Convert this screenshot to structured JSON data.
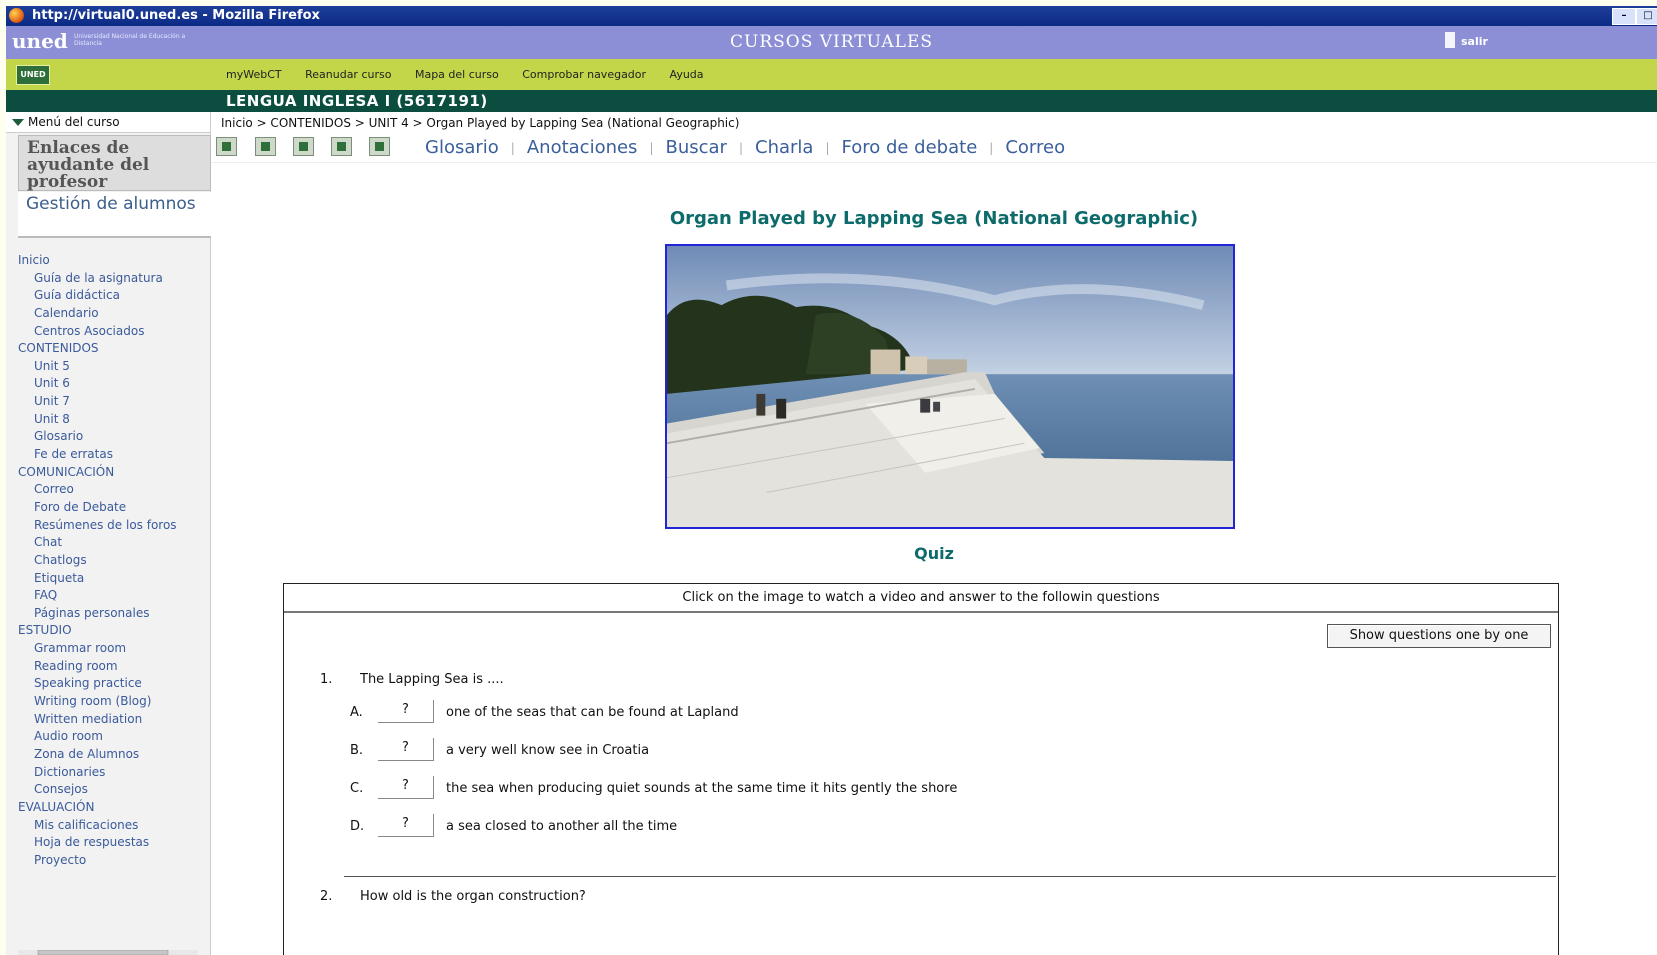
{
  "window": {
    "title": "http://virtual0.uned.es - Mozilla Firefox",
    "buttons": [
      "–",
      "□"
    ]
  },
  "header": {
    "logo": "uned",
    "logo_subtitle": "Universidad Nacional de Educación a Distancia",
    "title": "CURSOS VIRTUALES",
    "exit": "salir",
    "badge": "UNED"
  },
  "nav": {
    "items": [
      "myWebCT",
      "Reanudar curso",
      "Mapa del curso",
      "Comprobar navegador",
      "Ayuda"
    ]
  },
  "course": {
    "title": "LENGUA INGLESA I  (5617191)"
  },
  "sidebar": {
    "menu_title": "Menú del curso",
    "help_box": "Enlaces de ayudante del profesor",
    "gestion": "Gestión de alumnos",
    "entries": [
      {
        "label": "Inicio",
        "type": "sec"
      },
      {
        "label": "Guía de la asignatura",
        "type": "itm"
      },
      {
        "label": "Guía didáctica",
        "type": "itm"
      },
      {
        "label": "Calendario",
        "type": "itm"
      },
      {
        "label": "Centros Asociados",
        "type": "itm"
      },
      {
        "label": "CONTENIDOS",
        "type": "sec"
      },
      {
        "label": "Unit 5",
        "type": "itm"
      },
      {
        "label": "Unit 6",
        "type": "itm"
      },
      {
        "label": "Unit 7",
        "type": "itm"
      },
      {
        "label": "Unit 8",
        "type": "itm"
      },
      {
        "label": "Glosario",
        "type": "itm"
      },
      {
        "label": "Fe de erratas",
        "type": "itm"
      },
      {
        "label": "COMUNICACIÓN",
        "type": "sec"
      },
      {
        "label": "Correo",
        "type": "itm"
      },
      {
        "label": "Foro de Debate",
        "type": "itm"
      },
      {
        "label": "Resúmenes de los foros",
        "type": "itm"
      },
      {
        "label": "Chat",
        "type": "itm"
      },
      {
        "label": "Chatlogs",
        "type": "itm"
      },
      {
        "label": "Etiqueta",
        "type": "itm"
      },
      {
        "label": "FAQ",
        "type": "itm"
      },
      {
        "label": "Páginas personales",
        "type": "itm"
      },
      {
        "label": "ESTUDIO",
        "type": "sec"
      },
      {
        "label": "Grammar room",
        "type": "itm"
      },
      {
        "label": "Reading room",
        "type": "itm"
      },
      {
        "label": "Speaking practice",
        "type": "itm"
      },
      {
        "label": "Writing room (Blog)",
        "type": "itm"
      },
      {
        "label": "Written mediation",
        "type": "itm"
      },
      {
        "label": "Audio room",
        "type": "itm"
      },
      {
        "label": "Zona de Alumnos",
        "type": "itm"
      },
      {
        "label": "Dictionaries",
        "type": "itm"
      },
      {
        "label": "Consejos",
        "type": "itm"
      },
      {
        "label": "EVALUACIÓN",
        "type": "sec"
      },
      {
        "label": "Mis calificaciones",
        "type": "itm"
      },
      {
        "label": "Hoja de respuestas",
        "type": "itm"
      },
      {
        "label": "Proyecto",
        "type": "itm"
      }
    ]
  },
  "breadcrumb": "Inicio  >  CONTENIDOS  >  UNIT 4  >  Organ Played by Lapping Sea (National Geographic)",
  "toolnav": [
    "Glosario",
    "Anotaciones",
    "Buscar",
    "Charla",
    "Foro de debate",
    "Correo"
  ],
  "page": {
    "title": "Organ Played by Lapping Sea (National Geographic)",
    "quiz_label": "Quiz"
  },
  "quiz": {
    "instructions": "Click on the image to watch a video and answer to the followin questions",
    "show_button": "Show questions one by one",
    "q1": {
      "number": "1.",
      "text": "The Lapping Sea is ....",
      "options": [
        {
          "letter": "A.",
          "value": "?",
          "text": "one of the seas that can be found at Lapland"
        },
        {
          "letter": "B.",
          "value": "?",
          "text": "a very well know see in Croatia"
        },
        {
          "letter": "C.",
          "value": "?",
          "text": "the sea when producing quiet sounds at the same time it hits gently the shore"
        },
        {
          "letter": "D.",
          "value": "?",
          "text": "a sea closed to another all the time"
        }
      ]
    },
    "q2": {
      "number": "2.",
      "text": "How old is the organ construction?"
    }
  }
}
